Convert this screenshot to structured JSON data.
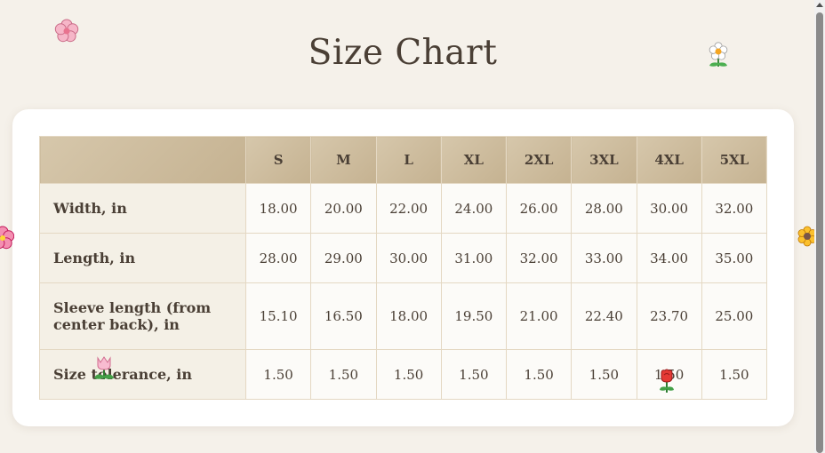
{
  "page": {
    "title": "Size Chart"
  },
  "table": {
    "columns": [
      "S",
      "M",
      "L",
      "XL",
      "2XL",
      "3XL",
      "4XL",
      "5XL"
    ],
    "rows": [
      {
        "label": "Width, in",
        "values": [
          "18.00",
          "20.00",
          "22.00",
          "24.00",
          "26.00",
          "28.00",
          "30.00",
          "32.00"
        ]
      },
      {
        "label": "Length, in",
        "values": [
          "28.00",
          "29.00",
          "30.00",
          "31.00",
          "32.00",
          "33.00",
          "34.00",
          "35.00"
        ]
      },
      {
        "label": "Sleeve length (from center back), in",
        "values": [
          "15.10",
          "16.50",
          "18.00",
          "19.50",
          "21.00",
          "22.40",
          "23.70",
          "25.00"
        ]
      },
      {
        "label": "Size tolerance, in",
        "values": [
          "1.50",
          "1.50",
          "1.50",
          "1.50",
          "1.50",
          "1.50",
          "1.50",
          "1.50"
        ]
      }
    ]
  },
  "decorations": [
    "cherry-blossom-icon",
    "daisy-icon",
    "hibiscus-icon",
    "sunflower-icon",
    "tulip-icon",
    "rose-icon"
  ],
  "colors": {
    "background": "#f5f1ea",
    "header": "#c5b291",
    "row_label_bg": "#f4f0e6",
    "text": "#4a3f35"
  }
}
